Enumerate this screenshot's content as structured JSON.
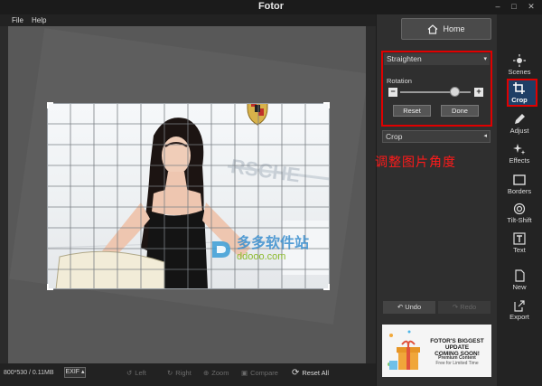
{
  "window": {
    "title": "Fotor",
    "controls": [
      "–",
      "□",
      "✕"
    ]
  },
  "menu": [
    "File",
    "Help"
  ],
  "status": {
    "dimensions": "800*530 / 0.11MB",
    "exif": "EXIF ▴"
  },
  "toolbar": {
    "left": "Left",
    "right": "Right",
    "zoom": "Zoom",
    "compare": "Compare",
    "reset_all": "Reset All"
  },
  "photo": {
    "brand_text": "RSCHE",
    "watermark_main": "多多软件站",
    "watermark_sub": "ddooo.com"
  },
  "panel": {
    "home": "Home",
    "straighten": {
      "title": "Straighten",
      "rotation_label": "Rotation",
      "rotation_value": 0.78,
      "reset": "Reset",
      "done": "Done"
    },
    "crop_title": "Crop",
    "annotation": "调整图片角度",
    "undo": "Undo",
    "redo": "Redo",
    "ad": {
      "line1a": "FOTOR'S BIGGEST UPDATE",
      "line1b": "COMING SOON!",
      "line2": "Premium Content",
      "line3": "Free for Limited Time"
    }
  },
  "sidebar": {
    "scenes": "Scenes",
    "crop": "Crop",
    "adjust": "Adjust",
    "effects": "Effects",
    "borders": "Borders",
    "tilt_shift": "Tilt-Shift",
    "text": "Text",
    "new": "New",
    "export": "Export"
  },
  "colors": {
    "highlight_red": "#e00000",
    "active_blue": "#1e3f66",
    "annotation_red": "#ff1a1a"
  }
}
